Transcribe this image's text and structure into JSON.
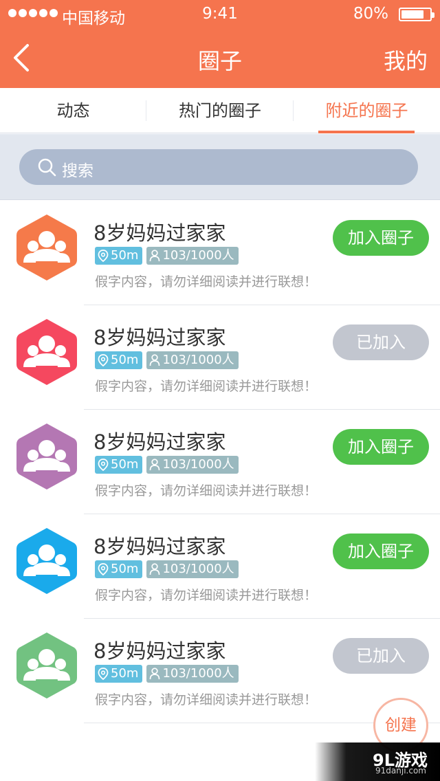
{
  "status_bar": {
    "carrier": "中国移动",
    "time": "9:41",
    "battery": "80%",
    "battery_level": 0.8
  },
  "nav": {
    "title": "圈子",
    "right_label": "我的",
    "back_icon": "chevron-left-icon"
  },
  "tabs": [
    {
      "label": "动态",
      "active": false
    },
    {
      "label": "热门的圈子",
      "active": false
    },
    {
      "label": "附近的圈子",
      "active": true
    }
  ],
  "search": {
    "placeholder": "搜索"
  },
  "items": [
    {
      "name": "8岁妈妈过家家",
      "distance": "50m",
      "members": "103/1000人",
      "desc": "假字内容，请勿详细阅读并进行联想！",
      "button": "加入圈子",
      "joined": false,
      "color": "#f57a4a"
    },
    {
      "name": "8岁妈妈过家家",
      "distance": "50m",
      "members": "103/1000人",
      "desc": "假字内容，请勿详细阅读并进行联想！",
      "button": "已加入",
      "joined": true,
      "color": "#f5485f"
    },
    {
      "name": "8岁妈妈过家家",
      "distance": "50m",
      "members": "103/1000人",
      "desc": "假字内容，请勿详细阅读并进行联想！",
      "button": "加入圈子",
      "joined": false,
      "color": "#b477b3"
    },
    {
      "name": "8岁妈妈过家家",
      "distance": "50m",
      "members": "103/1000人",
      "desc": "假字内容，请勿详细阅读并进行联想！",
      "button": "加入圈子",
      "joined": false,
      "color": "#1aaaeb"
    },
    {
      "name": "8岁妈妈过家家",
      "distance": "50m",
      "members": "103/1000人",
      "desc": "假字内容，请勿详细阅读并进行联想！",
      "button": "已加入",
      "joined": true,
      "color": "#72c281"
    }
  ],
  "fab": {
    "label": "创建"
  },
  "watermark": {
    "logo": "9L游戏",
    "url": "91danji.com"
  },
  "colors": {
    "accent": "#f5744e",
    "join": "#50c14b",
    "joined": "#c2c6cf"
  }
}
